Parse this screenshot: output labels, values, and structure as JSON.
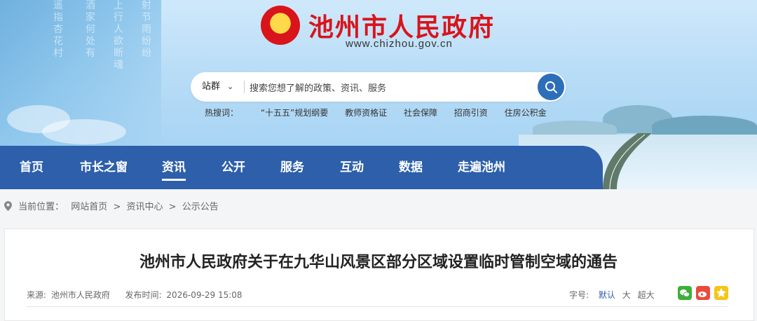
{
  "header": {
    "site_title": "池州市人民政府",
    "site_url": "www.chizhou.gov.cn",
    "calligraphy": [
      "遥指杏花村",
      "酒家何处有",
      "上行人欲断魂",
      "射节雨纷纷"
    ]
  },
  "search": {
    "scope_label": "站群",
    "placeholder": "搜索您想了解的政策、资讯、服务"
  },
  "hot_search": {
    "label": "热搜词：",
    "terms": [
      "“十五五”规划纲要",
      "教师资格证",
      "社会保障",
      "招商引资",
      "住房公积金"
    ]
  },
  "nav": {
    "items": [
      "首页",
      "市长之窗",
      "资讯",
      "公开",
      "服务",
      "互动",
      "数据",
      "走遍池州"
    ],
    "active": "资讯"
  },
  "breadcrumb": {
    "label": "当前位置：",
    "items": [
      "网站首页",
      "资讯中心",
      "公示公告"
    ],
    "separator": ">"
  },
  "article": {
    "title": "池州市人民政府关于在九华山风景区部分区域设置临时管制空域的通告",
    "source_label": "来源:",
    "source": "池州市人民政府",
    "date_label": "发布时间:",
    "date": "2026-09-29 15:08"
  },
  "font_size": {
    "label": "字号:",
    "options": [
      "默认",
      "大",
      "超大"
    ],
    "selected": "默认"
  },
  "share": {
    "icons": [
      "wechat-icon",
      "weibo-icon",
      "favorite-icon"
    ],
    "colors": [
      "#3db03a",
      "#e94b3c",
      "#f5c518"
    ]
  },
  "colors": {
    "brand_red": "#d9141b",
    "nav_blue": "#2d5faa",
    "accent_blue": "#2d6eba"
  }
}
